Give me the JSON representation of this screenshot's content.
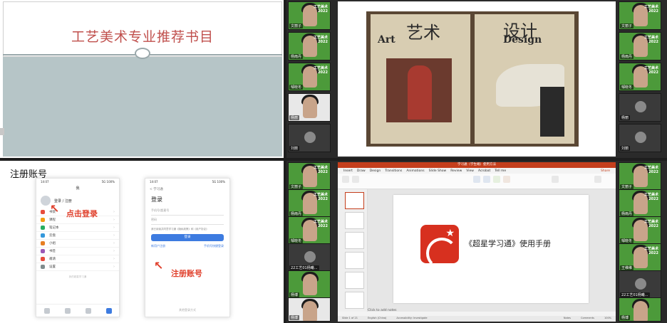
{
  "left_top": {
    "slide_title": "工艺美术专业推荐书目"
  },
  "left_bottom": {
    "heading": "注册账号",
    "phone1": {
      "time": "14:07",
      "status": "5G 100%",
      "header": "我",
      "login_text": "登录 / 注册",
      "menu": [
        "书架",
        "课程",
        "笔记本",
        "云盘",
        "小组",
        "书签",
        "邀请",
        "设置"
      ],
      "annotation": "点击登录",
      "footer": "我的超星学习通"
    },
    "phone2": {
      "time": "14:07",
      "back": "< 学习通",
      "title": "登录",
      "phone_placeholder": "手机号/超星号",
      "password_placeholder": "密码",
      "agree": "我已阅读并同意学习通《隐私政策》和《用户协议》",
      "login_button": "登录",
      "link_register": "新用户注册",
      "link_other": "手机号快捷登录",
      "annotation": "注册账号",
      "footer": "其他登录方式"
    }
  },
  "right_top": {
    "book1": {
      "cn": "艺术",
      "en": "Art"
    },
    "book2": {
      "cn": "设计",
      "en": "Design"
    },
    "video_tiles_left": [
      {
        "name": "文丽子"
      },
      {
        "name": "杨雨丹"
      },
      {
        "name": "邹晓冬"
      },
      {
        "name": "杨丽"
      },
      {
        "name": "刘丽"
      }
    ],
    "video_tiles_right": [
      {
        "name": "文丽子"
      },
      {
        "name": "杨雨丹"
      },
      {
        "name": "邹晓冬"
      },
      {
        "name": "杨丽"
      },
      {
        "name": "刘丽"
      }
    ]
  },
  "right_bottom": {
    "ppt": {
      "window_title": "学习通（学生端）使用方法",
      "menu": [
        "Insert",
        "Draw",
        "Design",
        "Transitions",
        "Animations",
        "Slide Show",
        "Review",
        "View",
        "Acrobat",
        "Tell me"
      ],
      "share": "Share",
      "slide_text": "《超星学习通》使用手册",
      "notes": "Click to add notes",
      "status": [
        "Slide 1 of 21",
        "English (China)",
        "Accessibility: Investigate",
        "Notes",
        "Comments",
        "100%"
      ]
    },
    "video_tiles_left": [
      {
        "name": "文丽子"
      },
      {
        "name": "杨雨丹"
      },
      {
        "name": "邹晓冬"
      },
      {
        "name": "22工艺01杨曦..."
      },
      {
        "name": "杨博"
      },
      {
        "name": "杨博"
      }
    ],
    "video_tiles_right": [
      {
        "name": "文丽子"
      },
      {
        "name": "杨雨丹"
      },
      {
        "name": "邹晓冬"
      },
      {
        "name": "王维维"
      },
      {
        "name": "22工艺01杨曦..."
      },
      {
        "name": "杨博"
      }
    ]
  }
}
